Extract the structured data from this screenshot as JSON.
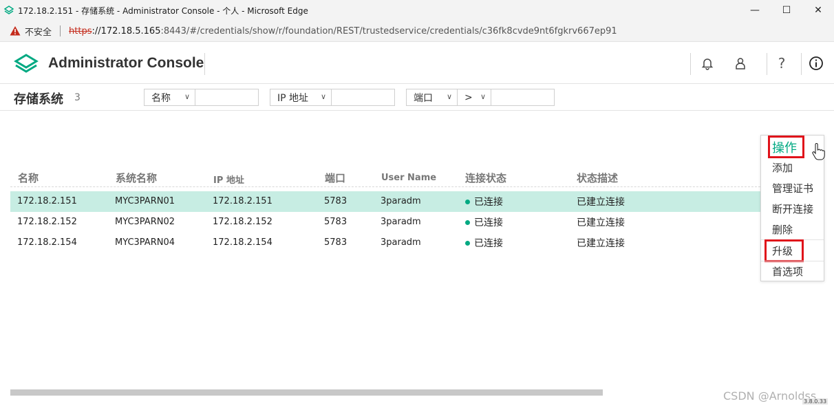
{
  "browser": {
    "window_title": "172.18.2.151 - 存储系统 - Administrator Console - 个人 - Microsoft Edge",
    "security_label": "不安全",
    "url_scheme": "https",
    "url_host": "://172.18.5.165",
    "url_rest": ":8443/#/credentials/show/r/foundation/REST/trustedservice/credentials/c36fk8cvde9nt6fgkrv667ep91",
    "minimize": "—",
    "maximize": "☐",
    "close": "✕"
  },
  "app": {
    "title": "Administrator Console",
    "icons": [
      "bell-icon",
      "user-icon",
      "help-icon",
      "info-icon"
    ],
    "accent_color": "#01a982",
    "help_glyph": "?"
  },
  "page": {
    "title": "存储系统",
    "count": "3"
  },
  "filters": {
    "name_label": "名称",
    "ip_label": "IP 地址",
    "port_label": "端口",
    "operator_label": ">"
  },
  "table": {
    "columns": [
      "名称",
      "系统名称",
      "IP 地址",
      "端口",
      "User Name",
      "连接状态",
      "状态描述"
    ],
    "rows": [
      {
        "name": "172.18.2.151",
        "system": "MYC3PARN01",
        "ip": "172.18.2.151",
        "port": "5783",
        "user": "3paradm",
        "status": "已连接",
        "desc": "已建立连接",
        "selected": true
      },
      {
        "name": "172.18.2.152",
        "system": "MYC3PARN02",
        "ip": "172.18.2.152",
        "port": "5783",
        "user": "3paradm",
        "status": "已连接",
        "desc": "已建立连接",
        "selected": false
      },
      {
        "name": "172.18.2.154",
        "system": "MYC3PARN04",
        "ip": "172.18.2.154",
        "port": "5783",
        "user": "3paradm",
        "status": "已连接",
        "desc": "已建立连接",
        "selected": false
      }
    ]
  },
  "actions_menu": {
    "title": "操作",
    "items": [
      "添加",
      "管理证书",
      "断开连接",
      "删除",
      "升级",
      "首选项"
    ],
    "highlight_color": "#e0121a"
  },
  "footer": {
    "watermark": "CSDN @Arnoldss",
    "version": "3.8.0.33"
  }
}
